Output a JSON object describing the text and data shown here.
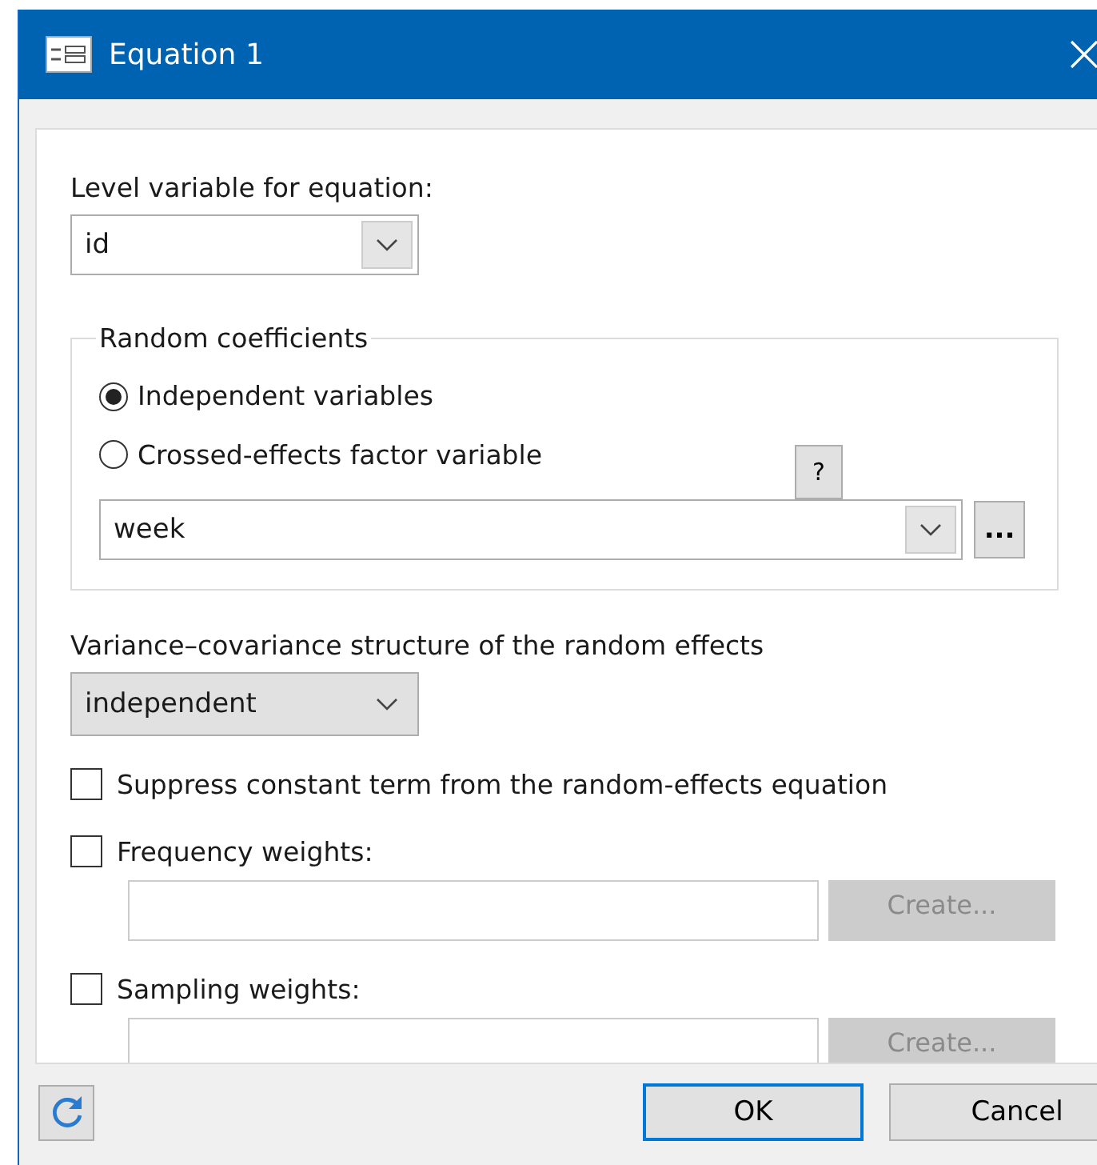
{
  "window": {
    "title": "Equation 1"
  },
  "level_variable": {
    "label": "Level variable for equation:",
    "value": "id"
  },
  "random_coefficients": {
    "legend": "Random coefficients",
    "options": [
      {
        "label": "Independent variables",
        "selected": true
      },
      {
        "label": "Crossed-effects factor variable",
        "selected": false
      }
    ],
    "help_button": "?",
    "factor_variable": "week",
    "browse_button": "..."
  },
  "covariance": {
    "label": "Variance–covariance structure of the random effects",
    "value": "independent"
  },
  "options": [
    {
      "kind": "checkbox",
      "label": "Suppress constant term from the random-effects equation",
      "checked": false
    },
    {
      "kind": "weight",
      "label": "Frequency weights:",
      "checked": false,
      "button": "Create..."
    },
    {
      "kind": "weight",
      "label": "Sampling weights:",
      "checked": false,
      "button": "Create..."
    }
  ],
  "buttons": [
    {
      "label": "OK",
      "default": true
    },
    {
      "label": "Cancel",
      "default": false
    }
  ]
}
